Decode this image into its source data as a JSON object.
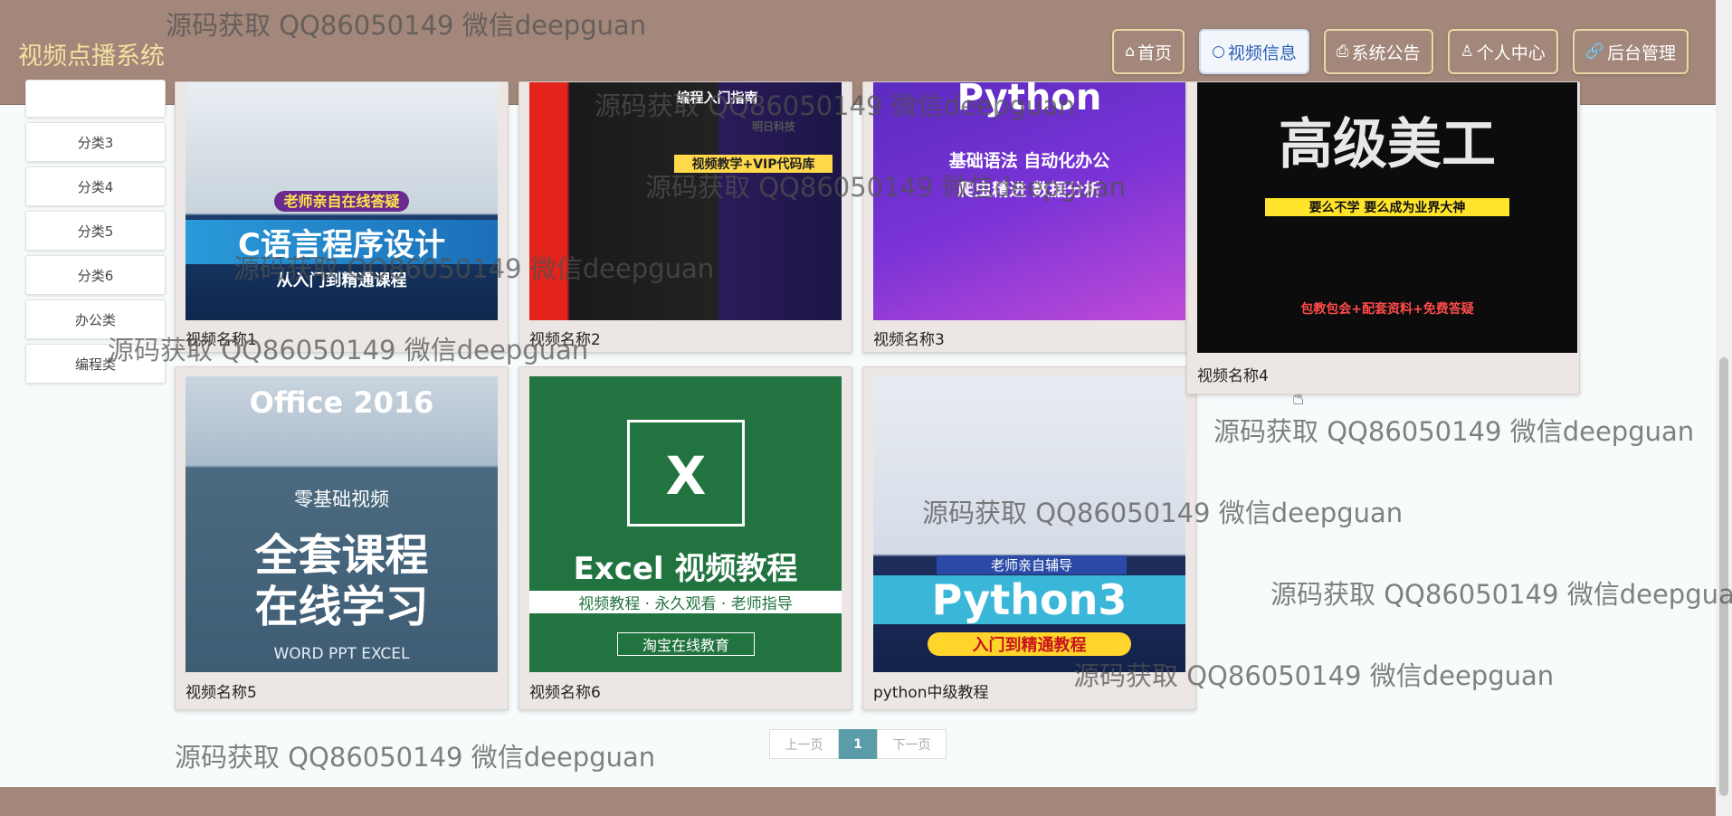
{
  "app": {
    "title": "视频点播系统"
  },
  "nav": [
    {
      "label": "首页",
      "icon": "home-icon",
      "glyph": "⌂"
    },
    {
      "label": "视频信息",
      "icon": "circle-icon",
      "glyph": "○"
    },
    {
      "label": "系统公告",
      "icon": "printer-icon",
      "glyph": "⎙"
    },
    {
      "label": "个人中心",
      "icon": "user-icon",
      "glyph": "♙"
    },
    {
      "label": "后台管理",
      "icon": "link-icon",
      "glyph": "🔗"
    }
  ],
  "sidebar": {
    "categories": [
      "分类3",
      "分类4",
      "分类5",
      "分类6",
      "办公类",
      "编程类"
    ]
  },
  "videos": [
    {
      "title": "视频名称1",
      "thumb_lines": [
        "老师亲自在线答疑",
        "C语言程序设计",
        "从入门到精通课程"
      ]
    },
    {
      "title": "视频名称2",
      "thumb_lines": [
        "编程入门指南",
        "视频教学+VIP代码库",
        "明日科技"
      ]
    },
    {
      "title": "视频名称3",
      "thumb_lines": [
        "Python",
        "基础语法  自动化办公",
        "爬虫精进  数据分析"
      ]
    },
    {
      "title": "视频名称4",
      "thumb_lines": [
        "高级美工",
        "要么不学 要么成为业界大神",
        "包教包会+配套资料+免费答疑"
      ]
    },
    {
      "title": "视频名称5",
      "thumb_lines": [
        "Office 2016",
        "零基础视频",
        "全套课程",
        "在线学习",
        "WORD   PPT   EXCEL"
      ]
    },
    {
      "title": "视频名称6",
      "thumb_lines": [
        "X",
        "Excel 视频教程",
        "视频教程 · 永久观看 · 老师指导",
        "淘宝在线教育"
      ]
    },
    {
      "title": "python中级教程",
      "thumb_lines": [
        "老师亲自辅导",
        "Python3",
        "入门到精通教程"
      ]
    }
  ],
  "pagination": {
    "prev": "上一页",
    "current": "1",
    "next": "下一页"
  },
  "watermark": "源码获取 QQ86050149 微信deepguan",
  "colors": {
    "header": "#a3877a",
    "title": "#f3e1a0",
    "accent": "#5a9ca8"
  }
}
